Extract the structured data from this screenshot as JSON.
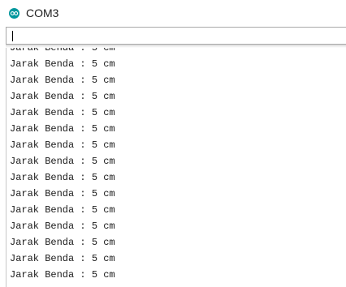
{
  "window": {
    "title": "COM3",
    "app_icon": "arduino-icon",
    "accent_color": "#00979d"
  },
  "send_input": {
    "value": ""
  },
  "serial_output": {
    "lines": [
      "Jarak Benda : 5 cm",
      "Jarak Benda : 5 cm",
      "Jarak Benda : 5 cm",
      "Jarak Benda : 5 cm",
      "Jarak Benda : 5 cm",
      "Jarak Benda : 5 cm",
      "Jarak Benda : 5 cm",
      "Jarak Benda : 5 cm",
      "Jarak Benda : 5 cm",
      "Jarak Benda : 5 cm",
      "Jarak Benda : 5 cm",
      "Jarak Benda : 5 cm",
      "Jarak Benda : 5 cm",
      "Jarak Benda : 5 cm",
      "Jarak Benda : 5 cm"
    ]
  }
}
